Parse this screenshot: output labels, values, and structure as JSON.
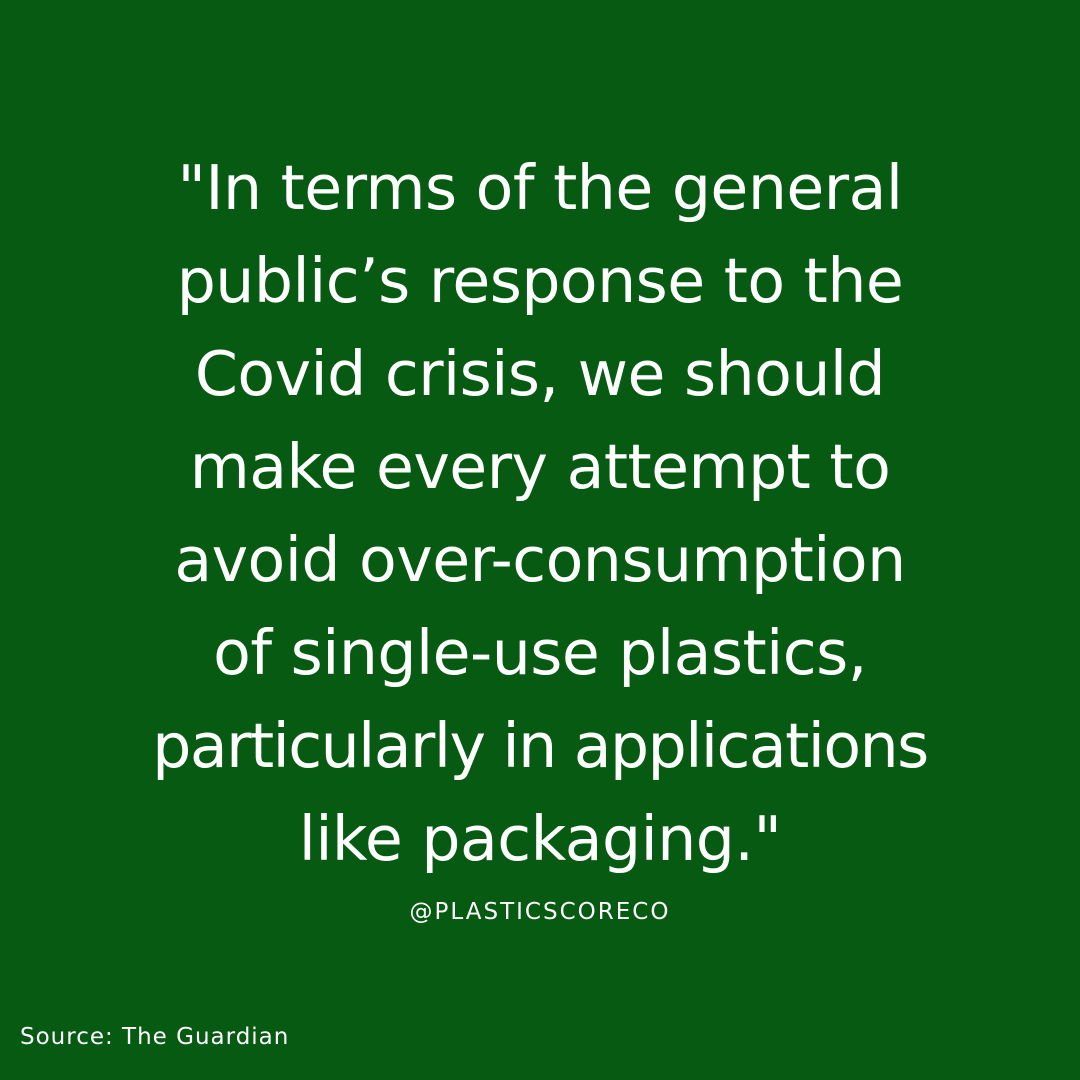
{
  "background_color": "#075A12",
  "text_color": "#FFFFFF",
  "quote": {
    "lines": [
      "\"In terms of the general",
      "public’s response to the",
      "Covid crisis, we should",
      "make every attempt to",
      "avoid over-consumption",
      "of single-use plastics,",
      "particularly in applications",
      "like packaging.\""
    ]
  },
  "handle": "@PLASTICSCORECO",
  "source": "Source: The Guardian"
}
